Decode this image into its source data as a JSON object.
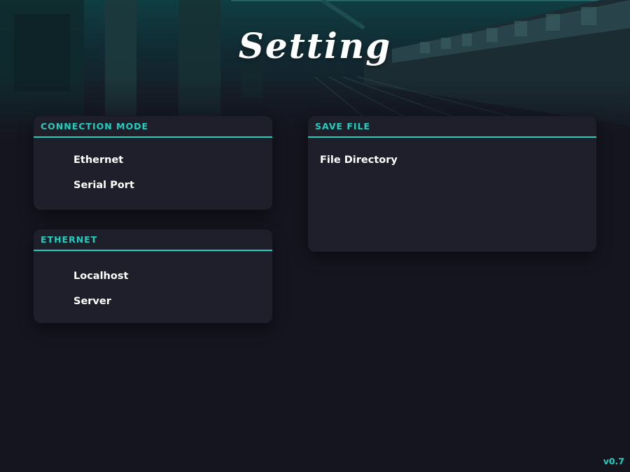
{
  "header": {
    "title": "Setting"
  },
  "connection_mode": {
    "title": "CONNECTION MODE",
    "options": [
      "Ethernet",
      "Serial Port"
    ]
  },
  "ethernet": {
    "title": "ETHERNET",
    "options": [
      "Localhost",
      "Server"
    ]
  },
  "save_file": {
    "title": "SAVE FILE",
    "options": [
      "File Directory"
    ]
  },
  "footer": {
    "version": "v0.7"
  },
  "colors": {
    "accent": "#22cfbf",
    "panel": "#1e1f2b",
    "background": "#14151f"
  }
}
